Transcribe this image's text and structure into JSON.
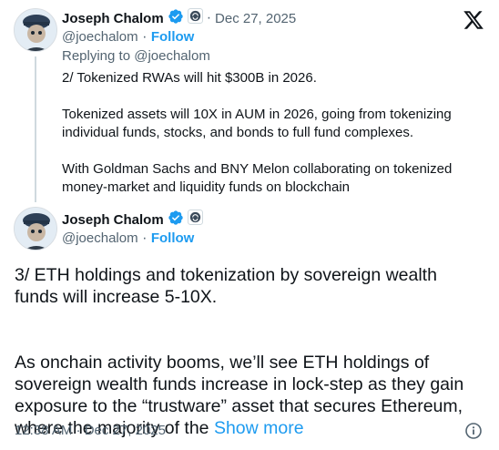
{
  "parent_tweet": {
    "author_name": "Joseph Chalom",
    "handle": "@joechalom",
    "follow_label": "Follow",
    "date": "Dec 27, 2025",
    "replying_to": "Replying to @joechalom",
    "text": "2/ Tokenized RWAs will hit $300B in 2026.\n\nTokenized assets will 10X in AUM in 2026, going from tokenizing individual funds, stocks, and bonds to full fund complexes.\n\nWith Goldman Sachs and BNY Melon collaborating on tokenized money-market and liquidity funds on blockchain"
  },
  "main_tweet": {
    "author_name": "Joseph Chalom",
    "handle": "@joechalom",
    "follow_label": "Follow",
    "text_p1": "3/ ETH holdings and tokenization by sovereign wealth funds will increase 5-10X.",
    "text_p2": "As onchain activity booms, we’ll see ETH holdings of sovereign wealth funds increase in lock-step as they gain exposure to the “trustware” asset that secures Ethereum, where the majority of the ",
    "show_more": "Show more",
    "timestamp": "12:38 AM · Dec 27, 2025"
  },
  "separator": "·",
  "icons": {
    "verified": "verified-badge-icon",
    "affiliate": "affiliate-org-icon",
    "x_logo": "x-logo-icon",
    "info": "info-icon"
  },
  "colors": {
    "link": "#1d9bf0",
    "secondary_text": "#536471",
    "verified": "#1d9bf0"
  }
}
